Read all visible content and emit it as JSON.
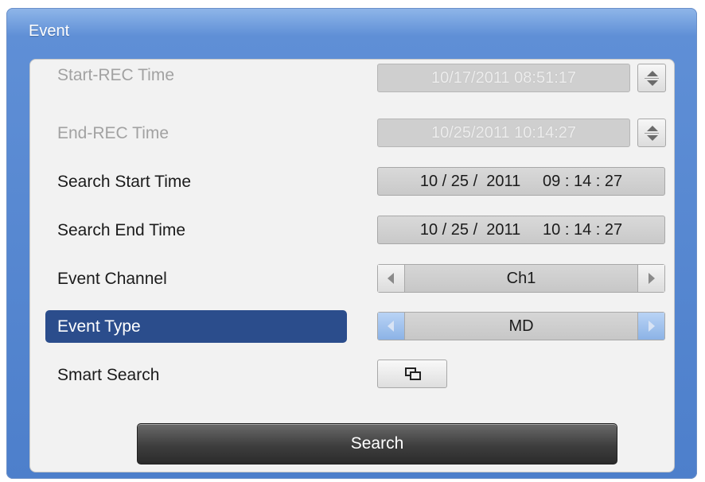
{
  "window": {
    "title": "Event"
  },
  "rows": {
    "start_rec": {
      "label": "Start-REC Time",
      "value": "10/17/2011 08:51:17"
    },
    "end_rec": {
      "label": "End-REC Time",
      "value": "10/25/2011 10:14:27"
    },
    "search_start": {
      "label": "Search Start Time",
      "value": "10 / 25 /  2011     09 : 14 : 27"
    },
    "search_end": {
      "label": "Search End Time",
      "value": "10 / 25 /  2011     10 : 14 : 27"
    },
    "event_channel": {
      "label": "Event Channel",
      "value": "Ch1"
    },
    "event_type": {
      "label": "Event Type",
      "value": "MD"
    },
    "smart_search": {
      "label": "Smart Search",
      "icon": "smart-search-icon"
    }
  },
  "search_button": {
    "label": "Search"
  },
  "colors": {
    "title_bar": "#5f8fd6",
    "selected_row": "#2b4d8c",
    "panel": "#f2f2f2",
    "search_button": "#3e3e3e"
  }
}
